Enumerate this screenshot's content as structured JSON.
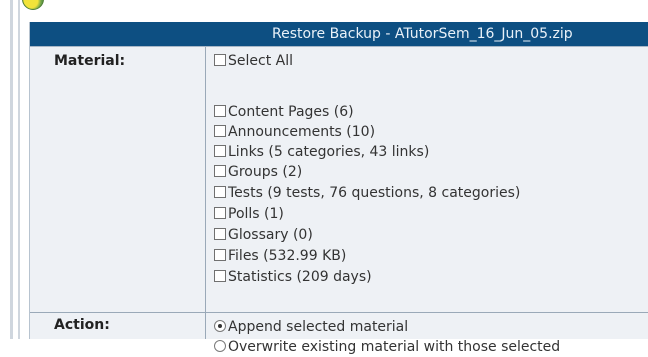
{
  "title": "Restore Backup - ATutorSem_16_Jun_05.zip",
  "material": {
    "label": "Material:",
    "select_all": "Select All",
    "items": [
      "Content Pages (6)",
      "Announcements (10)",
      "Links (5 categories, 43 links)",
      "Groups (2)",
      "Tests (9 tests, 76 questions, 8 categories)",
      "Polls (1)",
      "Glossary (0)",
      "Files (532.99 KB)",
      "Statistics (209 days)"
    ]
  },
  "action": {
    "label": "Action:",
    "options": [
      {
        "label": "Append selected material",
        "selected": true
      },
      {
        "label": "Overwrite existing material with those selected",
        "selected": false
      }
    ]
  }
}
